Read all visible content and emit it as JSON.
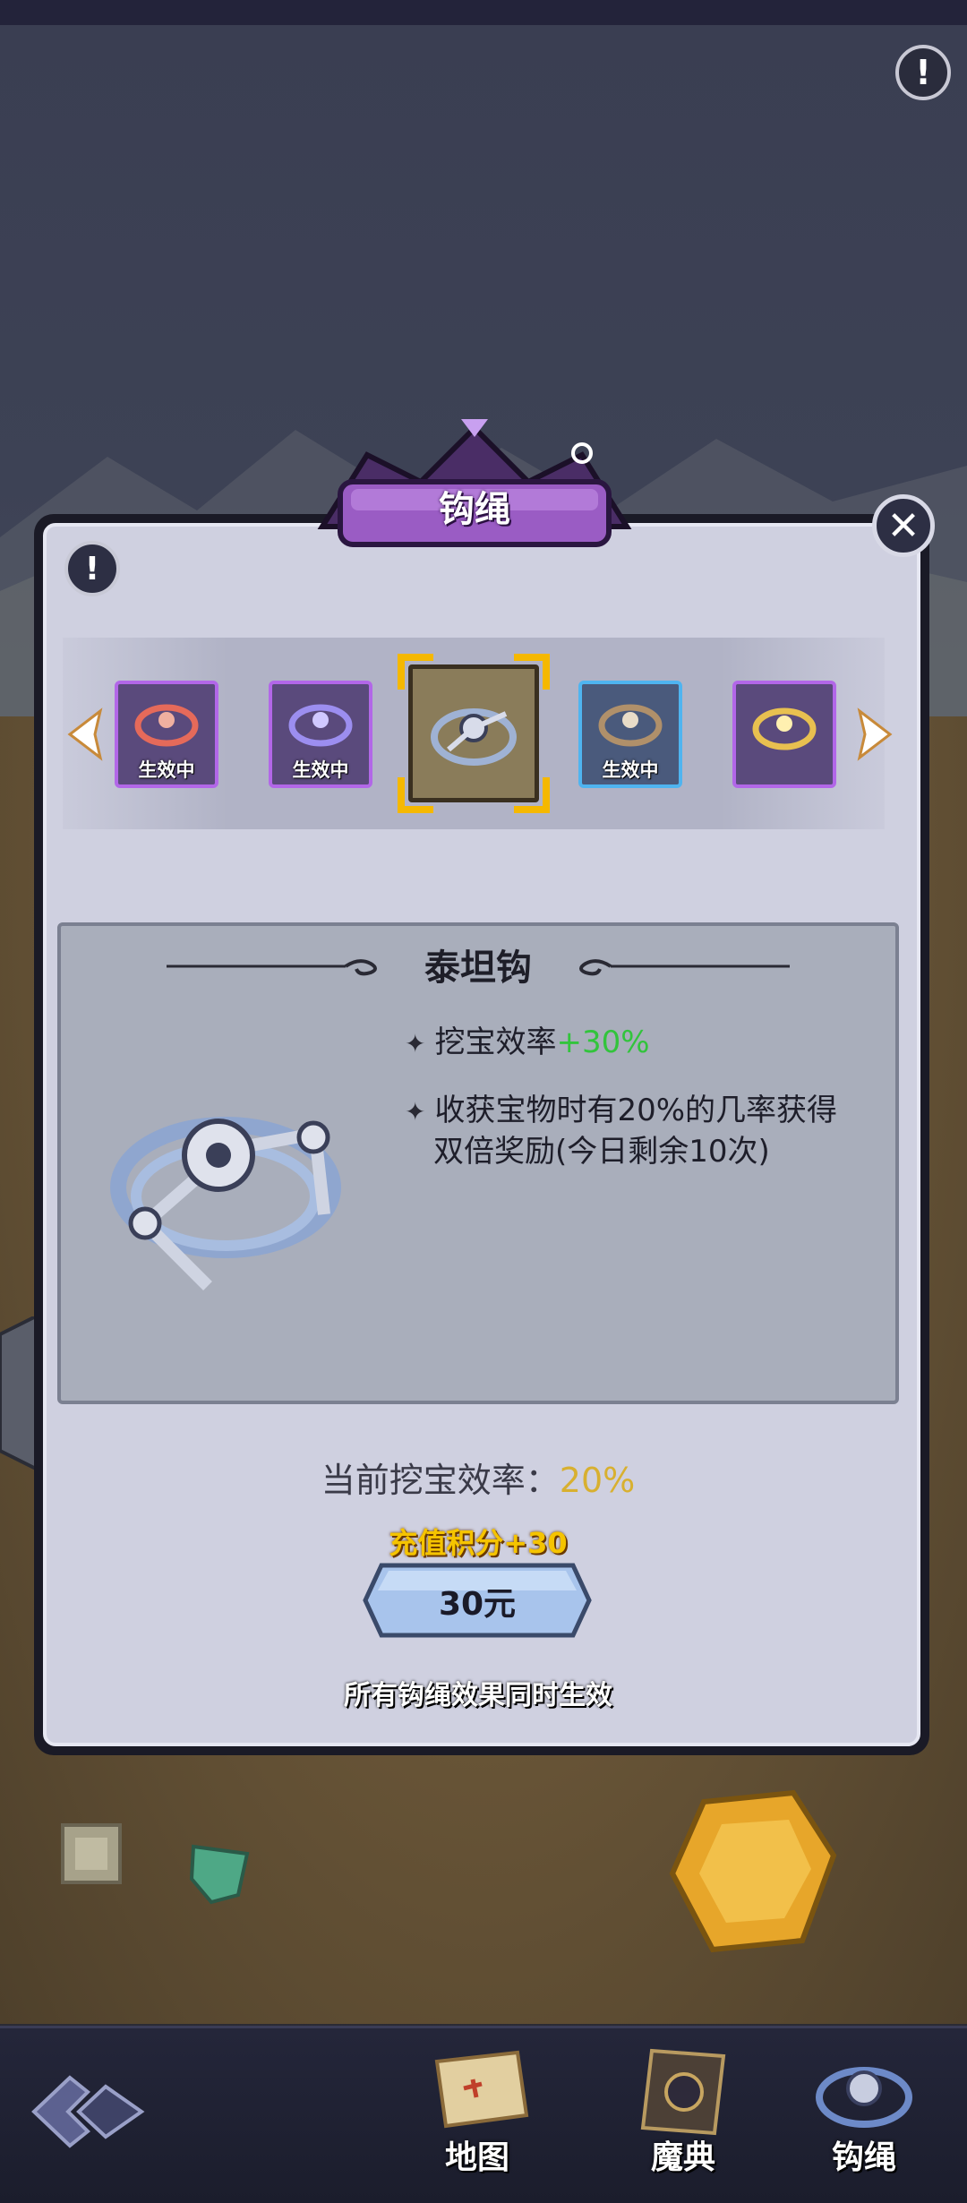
{
  "dialog": {
    "title": "钩绳",
    "items": [
      {
        "name": "red-hook",
        "badge": "生效中",
        "frame": "purple"
      },
      {
        "name": "violet-hook",
        "badge": "生效中",
        "frame": "purple"
      },
      {
        "name": "titan-hook",
        "badge": "",
        "frame": "gold"
      },
      {
        "name": "bronze-hook",
        "badge": "生效中",
        "frame": "blue"
      },
      {
        "name": "gold-hook",
        "badge": "",
        "frame": "purple"
      }
    ],
    "detail": {
      "name": "泰坦钩",
      "effect1_label": "挖宝效率",
      "effect1_value": "+30%",
      "effect2_line1": "收获宝物时有20%的几率获得",
      "effect2_line2": "双倍奖励(今日剩余10次)"
    },
    "current_rate_label": "当前挖宝效率：",
    "current_rate_value": "20%",
    "points": "充值积分+30",
    "buy_label": "30元",
    "footnote": "所有钩绳效果同时生效"
  },
  "nav": {
    "map": "地图",
    "book": "魔典",
    "hook": "钩绳"
  },
  "colors": {
    "highlight_green": "#32c43c",
    "rate_gold": "#d8b030",
    "points_yellow": "#f5c400",
    "frame_purple": "#b267e8",
    "frame_blue": "#4fb4f0"
  }
}
